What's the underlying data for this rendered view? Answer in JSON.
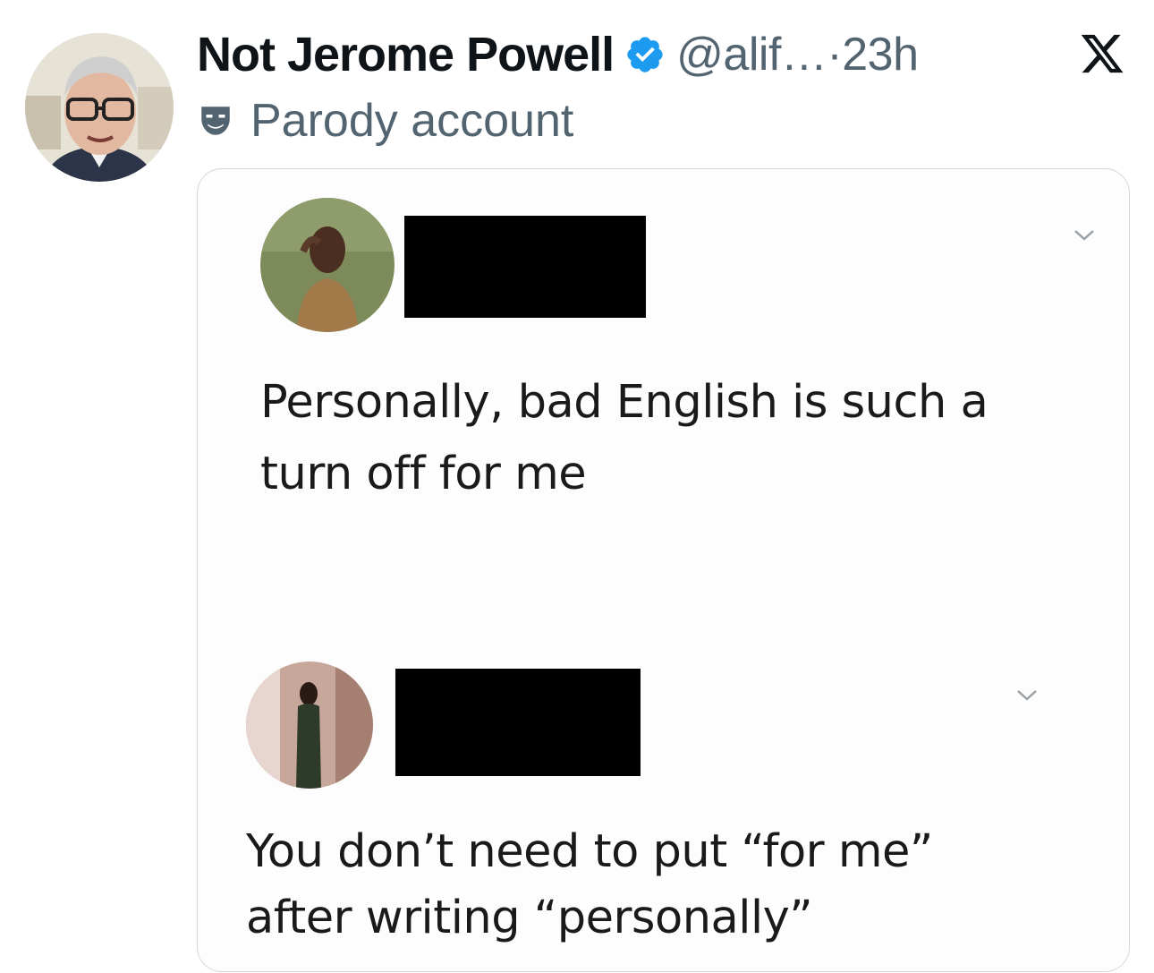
{
  "tweet": {
    "display_name": "Not Jerome Powell",
    "handle": "@alif…",
    "separator": "·",
    "time": "23h",
    "label": "Parody account",
    "icons": [
      "verified-badge-icon",
      "x-logo-icon",
      "parody-mask-icon"
    ],
    "accent_color": "#1d9bf0"
  },
  "media": {
    "comments": [
      {
        "text_lines": [
          "Personally, bad English is such a",
          "turn off for me"
        ],
        "icons": [
          "chevron-down-icon"
        ]
      },
      {
        "text_lines": [
          "You don’t need to put “for me”",
          "after writing “personally”"
        ],
        "icons": [
          "chevron-down-icon"
        ]
      }
    ]
  }
}
